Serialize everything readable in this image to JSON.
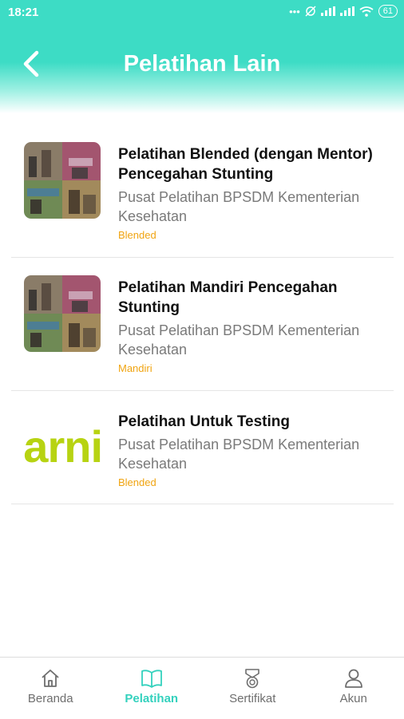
{
  "status_bar": {
    "time": "18:21",
    "battery": "61"
  },
  "header": {
    "title": "Pelatihan Lain"
  },
  "courses": [
    {
      "title": "Pelatihan Blended (dengan Mentor) Pencegahan Stunting",
      "provider": "Pusat Pelatihan BPSDM Kementerian Kesehatan",
      "type": "Blended"
    },
    {
      "title": "Pelatihan Mandiri Pencegahan Stunting",
      "provider": "Pusat Pelatihan BPSDM Kementerian Kesehatan",
      "type": "Mandiri"
    },
    {
      "title": "Pelatihan Untuk Testing",
      "provider": "Pusat Pelatihan BPSDM Kementerian Kesehatan",
      "type": "Blended",
      "logo_text": "arni"
    }
  ],
  "bottom_nav": [
    {
      "label": "Beranda",
      "icon": "home-icon"
    },
    {
      "label": "Pelatihan",
      "icon": "book-icon",
      "active": true
    },
    {
      "label": "Sertifikat",
      "icon": "certificate-icon"
    },
    {
      "label": "Akun",
      "icon": "user-icon"
    }
  ],
  "colors": {
    "accent": "#3ddcc5",
    "badge": "#f0a411",
    "logo": "#b7d312"
  }
}
